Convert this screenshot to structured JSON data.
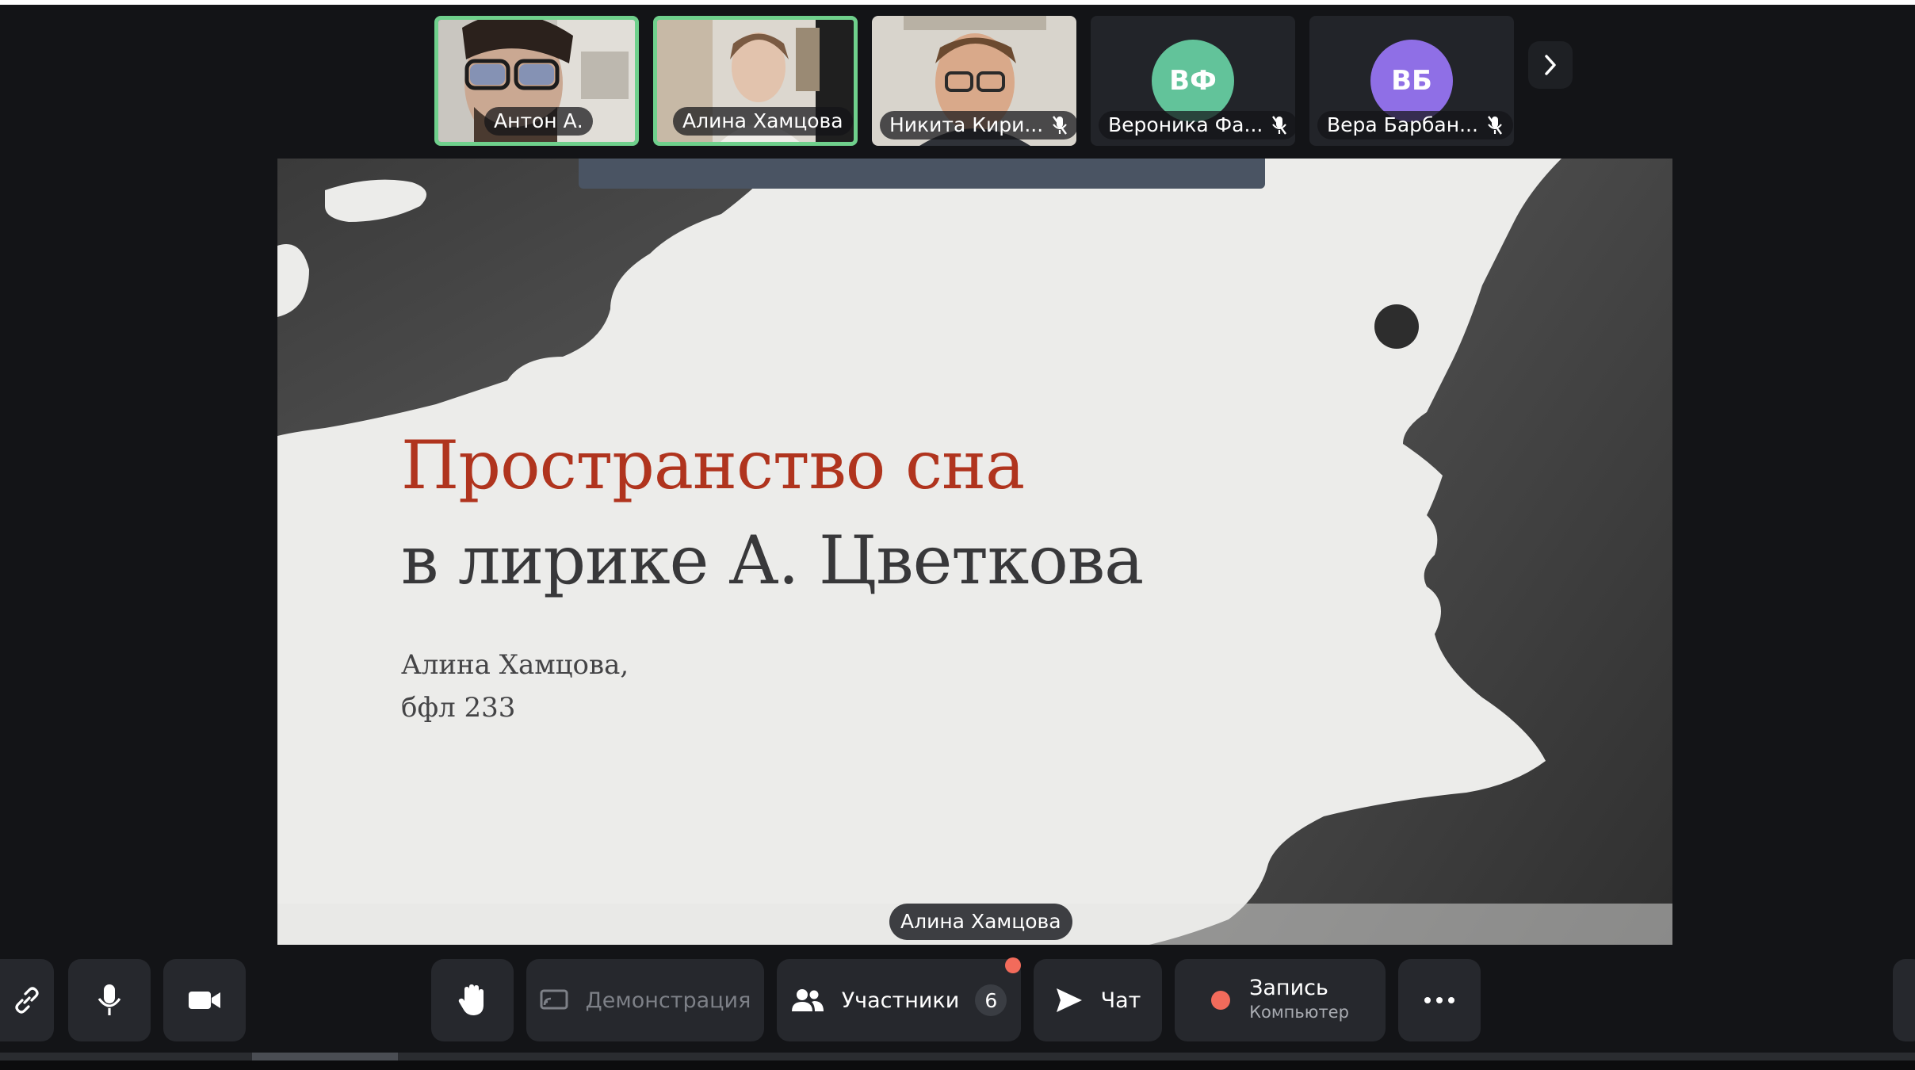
{
  "participants": [
    {
      "name": "Антон А.",
      "active": true,
      "mic_muted": false
    },
    {
      "name": "Алина Хамцова",
      "active": true,
      "mic_muted": false
    },
    {
      "name": "Никита Кири...",
      "active": false,
      "mic_muted": true
    },
    {
      "name": "Вероника Фа...",
      "initials": "ВФ",
      "avatar_color": "#62c39a",
      "mic_muted": true
    },
    {
      "name": "Вера Барбан...",
      "initials": "ВБ",
      "avatar_color": "#8f6fe6",
      "mic_muted": true
    }
  ],
  "slide": {
    "title_line1": "Пространство сна",
    "title_line2": "в лирике А. Цветкова",
    "author_line1": "Алина Хамцова,",
    "author_line2": "бфл 233",
    "title_color": "#b0341e"
  },
  "presenter_label": "Алина Хамцова",
  "controls": {
    "demo_label": "Демонстрация",
    "participants_label": "Участники",
    "participants_count": "6",
    "chat_label": "Чат",
    "record_label": "Запись",
    "record_sub": "Компьютер"
  },
  "colors": {
    "active_border": "#6fd08c",
    "record_dot": "#f26b5b",
    "background": "#131417"
  }
}
